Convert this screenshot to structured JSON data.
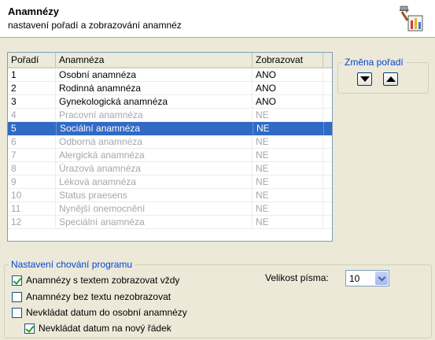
{
  "header": {
    "title": "Anamnézy",
    "subtitle": "nastavení pořadí a zobrazování anamnéz",
    "icon": "tools-settings-icon"
  },
  "list": {
    "columns": [
      "Pořadí",
      "Anamnéza",
      "Zobrazovat"
    ],
    "rows": [
      {
        "order": "1",
        "name": "Osobní anamnéza",
        "show": "ANO",
        "state": "enabled"
      },
      {
        "order": "2",
        "name": "Rodinná anamnéza",
        "show": "ANO",
        "state": "enabled"
      },
      {
        "order": "3",
        "name": "Gynekologická anamnéza",
        "show": "ANO",
        "state": "enabled"
      },
      {
        "order": "4",
        "name": "Pracovní anamnéza",
        "show": "NE",
        "state": "disabled"
      },
      {
        "order": "5",
        "name": "Sociální anamnéza",
        "show": "NE",
        "state": "selected"
      },
      {
        "order": "6",
        "name": "Odborná anamnéza",
        "show": "NE",
        "state": "disabled"
      },
      {
        "order": "7",
        "name": "Alergická anamnéza",
        "show": "NE",
        "state": "disabled"
      },
      {
        "order": "8",
        "name": "Úrazová anamnéza",
        "show": "NE",
        "state": "disabled"
      },
      {
        "order": "9",
        "name": "Léková anamnéza",
        "show": "NE",
        "state": "disabled"
      },
      {
        "order": "10",
        "name": "Status praesens",
        "show": "NE",
        "state": "disabled"
      },
      {
        "order": "11",
        "name": "Nynější onemocnění",
        "show": "NE",
        "state": "disabled"
      },
      {
        "order": "12",
        "name": "Speciální anamnéza",
        "show": "NE",
        "state": "disabled"
      }
    ]
  },
  "order_group": {
    "legend": "Změna pořadí",
    "down_icon": "arrow-down-icon",
    "up_icon": "arrow-up-icon"
  },
  "settings": {
    "legend": "Nastavení chování programu",
    "checkboxes": [
      {
        "label": "Anamnézy s textem zobrazovat vždy",
        "checked": true
      },
      {
        "label": "Anamnézy bez textu nezobrazovat",
        "checked": false
      },
      {
        "label": "Nevkládat datum do osobní anamnézy",
        "checked": false
      },
      {
        "label": "Nevkládat datum na nový řádek",
        "checked": true
      }
    ],
    "font_size_label": "Velikost písma:",
    "font_size_value": "10"
  },
  "colors": {
    "selection": "#316ac5",
    "group_legend": "#0046d5",
    "window_bg": "#ece9d8"
  }
}
